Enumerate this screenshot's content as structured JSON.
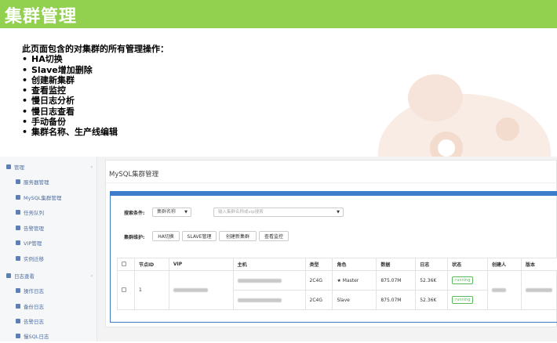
{
  "slide": {
    "title": "集群管理",
    "intro": "此页面包含的对集群的所有管理操作：",
    "bullets": [
      "HA切换",
      "Slave增加删除",
      "创建新集群",
      "查看监控",
      "慢日志分析",
      "慢日志查看",
      "手动备份",
      "集群名称、生产线编辑"
    ]
  },
  "sidebar": {
    "groups": [
      {
        "label": "管理",
        "items": [
          "服务器管理",
          "MySQL集群管理",
          "任务队列",
          "告警管理",
          "VIP管理",
          "实例迁移"
        ]
      },
      {
        "label": "日志查看",
        "items": [
          "操作日志",
          "备份日志",
          "告警日志",
          "慢SQL日志"
        ]
      }
    ],
    "caret": "‹"
  },
  "panel": {
    "title": "MySQL集群管理",
    "search_label": "搜索条件:",
    "search_select": "集群名称",
    "search_placeholder": "输入集群名称或vip搜索",
    "maintain_label": "集群维护:",
    "buttons": [
      "HA切换",
      "SLAVE管理",
      "创建新集群",
      "查看监控"
    ]
  },
  "table": {
    "headers": [
      "节点ID",
      "VIP",
      "主机",
      "类型",
      "角色",
      "数据",
      "日志",
      "状态",
      "创建人",
      "版本"
    ],
    "node_id": "1",
    "rows": [
      {
        "type": "2C4G",
        "role": "Master",
        "role_icon": "star-icon",
        "data": "875.07M",
        "log": "52.36K",
        "status": "running"
      },
      {
        "type": "2C4G",
        "role": "Slave",
        "data": "875.07M",
        "log": "52.36K",
        "status": "running"
      }
    ]
  },
  "colors": {
    "header_green": "#92d050",
    "panel_blue": "#3d7cc9",
    "running_green": "#5cb85c"
  }
}
